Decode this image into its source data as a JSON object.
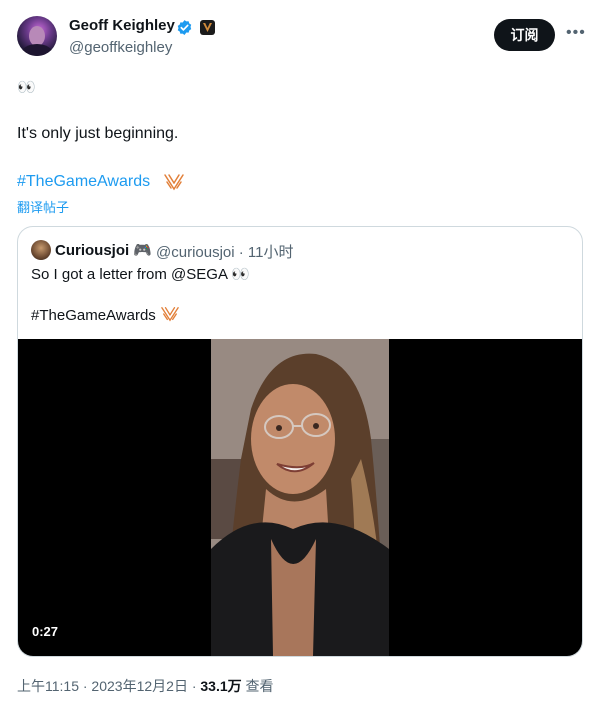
{
  "author": {
    "name": "Geoff Keighley",
    "handle": "@geoffkeighley",
    "verified_color": "#1d9bf0"
  },
  "header": {
    "subscribe_label": "订阅",
    "more_icon": "more-horizontal-icon"
  },
  "tweet": {
    "emoji_line": "👀",
    "text": "It's only just beginning.",
    "hashtag": "#TheGameAwards",
    "translate_label": "翻译帖子"
  },
  "quote": {
    "name": "Curiousjoi 🎮",
    "handle_time": "@curiousjoi · 11小时",
    "text": "So I got a letter from @SEGA 👀",
    "hashtag": "#TheGameAwards",
    "video_duration": "0:27"
  },
  "meta": {
    "time_date": "上午11:15 · 2023年12月2日 · ",
    "views_count": "33.1万",
    "views_label": " 查看"
  },
  "colors": {
    "accent": "#1d9bf0",
    "text": "#0f1419",
    "secondary": "#536471",
    "awards_orange": "#e2803a"
  }
}
